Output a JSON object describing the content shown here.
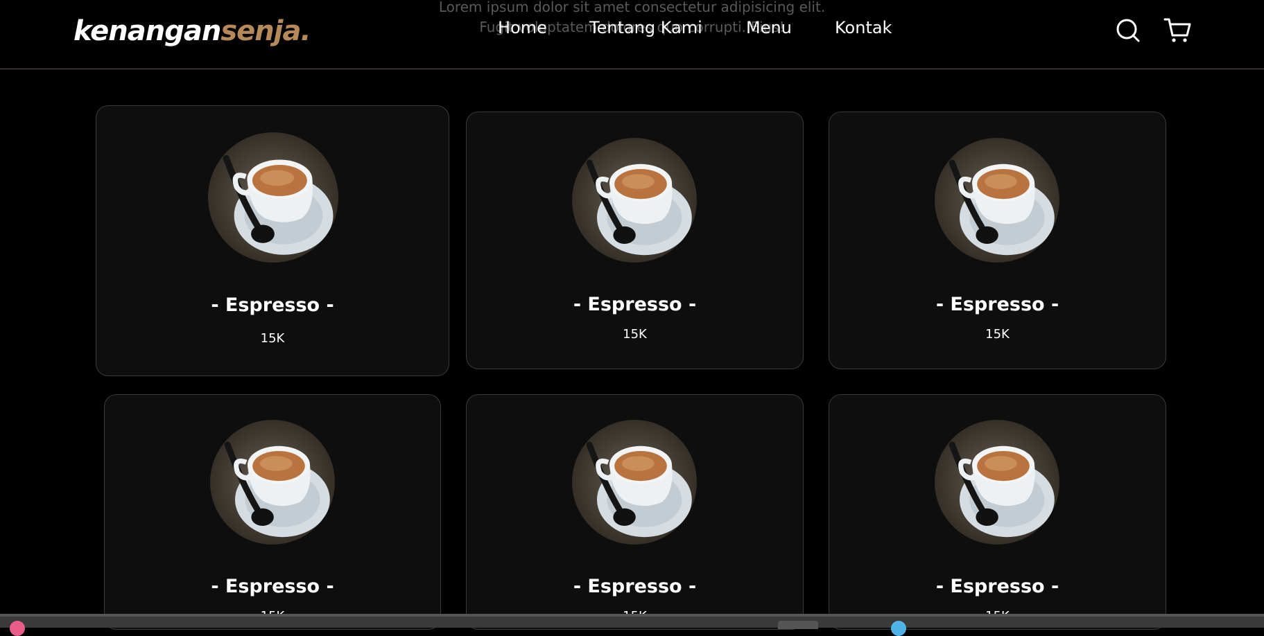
{
  "background_text": {
    "line1": "Lorem ipsum dolor sit amet consectetur adipisicing elit.",
    "line2": "Fugit voluptatem dolores quo corrupti. Eius!"
  },
  "navbar": {
    "logo_main": "kenangan",
    "logo_accent": "senja.",
    "links": [
      "Home",
      "Tentang Kami",
      "Menu",
      "Kontak"
    ],
    "icons": [
      "search-icon",
      "shopping-cart-icon"
    ]
  },
  "menu_items": [
    {
      "name": "- Espresso -",
      "price": "15K"
    },
    {
      "name": "- Espresso -",
      "price": "15K"
    },
    {
      "name": "- Espresso -",
      "price": "15K"
    },
    {
      "name": "- Espresso -",
      "price": "15K"
    },
    {
      "name": "- Espresso -",
      "price": "15K"
    },
    {
      "name": "- Espresso -",
      "price": "15K"
    }
  ],
  "colors": {
    "accent": "#b6895b",
    "background": "#000000",
    "card_background": "#0e0e0e",
    "card_border": "#3a3a3a"
  }
}
